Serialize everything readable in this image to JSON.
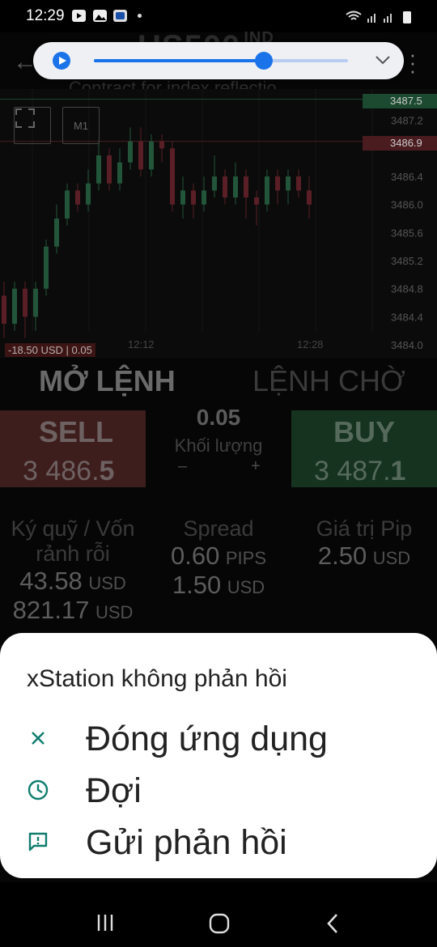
{
  "status_bar": {
    "time": "12:29"
  },
  "app_header": {
    "title": "US500",
    "title_suffix": "IND",
    "subtitle": "Contract for index reflectio"
  },
  "media_player": {
    "progress": 0.67
  },
  "chart": {
    "buttons": {
      "timeframe": "M1"
    },
    "price_tags": {
      "ask": "3487.5",
      "bid": "3486.9"
    },
    "pnl_label": "-18.50 USD | 0.05",
    "x_ticks": [
      "12:12",
      "12:28"
    ],
    "chart_data": {
      "type": "candlestick",
      "y_ticks": [
        "3487.2",
        "3486.4",
        "3486.0",
        "3485.6",
        "3485.2",
        "3484.8",
        "3484.4",
        "3484.0"
      ],
      "ylim": [
        3484.0,
        3487.6
      ],
      "candles": [
        [
          3484.7,
          3484.3,
          3484.9,
          3484.1
        ],
        [
          3484.3,
          3484.8,
          3484.9,
          3484.2
        ],
        [
          3484.8,
          3484.4,
          3484.9,
          3484.1
        ],
        [
          3484.4,
          3484.8,
          3484.9,
          3484.2
        ],
        [
          3484.8,
          3485.4,
          3485.5,
          3484.7
        ],
        [
          3485.4,
          3485.8,
          3486.0,
          3485.3
        ],
        [
          3485.8,
          3486.2,
          3486.3,
          3485.7
        ],
        [
          3486.2,
          3486.0,
          3486.3,
          3485.9
        ],
        [
          3486.0,
          3486.3,
          3486.5,
          3485.9
        ],
        [
          3486.3,
          3486.7,
          3486.9,
          3486.2
        ],
        [
          3486.7,
          3486.3,
          3486.8,
          3486.2
        ],
        [
          3486.3,
          3486.6,
          3486.8,
          3486.2
        ],
        [
          3486.6,
          3486.9,
          3487.1,
          3486.5
        ],
        [
          3486.9,
          3486.5,
          3487.1,
          3486.4
        ],
        [
          3486.5,
          3486.9,
          3487.0,
          3486.4
        ],
        [
          3486.9,
          3486.8,
          3487.0,
          3486.6
        ],
        [
          3486.8,
          3486.0,
          3486.9,
          3485.9
        ],
        [
          3486.0,
          3486.2,
          3486.4,
          3485.8
        ],
        [
          3486.2,
          3486.0,
          3486.3,
          3485.8
        ],
        [
          3486.0,
          3486.2,
          3486.4,
          3485.9
        ],
        [
          3486.2,
          3486.4,
          3486.7,
          3486.1
        ],
        [
          3486.4,
          3486.1,
          3486.5,
          3486.0
        ],
        [
          3486.1,
          3486.4,
          3486.6,
          3486.0
        ],
        [
          3486.4,
          3486.1,
          3486.5,
          3485.8
        ],
        [
          3486.1,
          3486.0,
          3486.2,
          3485.7
        ],
        [
          3486.0,
          3486.4,
          3486.5,
          3485.9
        ],
        [
          3486.4,
          3486.2,
          3486.5,
          3486.0
        ],
        [
          3486.2,
          3486.4,
          3486.5,
          3486.0
        ],
        [
          3486.4,
          3486.2,
          3486.5,
          3486.1
        ],
        [
          3486.2,
          3486.0,
          3486.4,
          3485.8
        ]
      ]
    }
  },
  "order_panel": {
    "tabs": {
      "open": "MỞ LỆNH",
      "pending": "LỆNH CHỜ"
    },
    "sell": {
      "label": "SELL",
      "price_main": "3 486.",
      "price_last": "5"
    },
    "buy": {
      "label": "BUY",
      "price_main": "3 487.",
      "price_last": "1"
    },
    "volume": {
      "value": "0.05",
      "label": "Khối lượng",
      "minus": "–",
      "plus": "+"
    },
    "margin": {
      "label1": "Ký quỹ / Vốn",
      "label2": "rảnh rỗi",
      "value1": "43.58",
      "value2": "821.17",
      "unit": "USD"
    },
    "spread": {
      "label": "Spread",
      "value1": "0.60",
      "unit1": "PIPS",
      "value2": "1.50",
      "unit2": "USD"
    },
    "pip_value": {
      "label": "Giá trị Pip",
      "value": "2.50",
      "unit": "USD"
    }
  },
  "dialog": {
    "title": "xStation không phản hồi",
    "items": [
      {
        "label": "Đóng ứng dụng",
        "icon": "close-icon"
      },
      {
        "label": "Đợi",
        "icon": "clock-icon"
      },
      {
        "label": "Gửi phản hồi",
        "icon": "feedback-icon"
      }
    ]
  },
  "colors": {
    "accent": "#1a73e8",
    "dialog_icon": "#0f7c6e",
    "bull": "#22553a",
    "bear": "#5a1f26"
  }
}
